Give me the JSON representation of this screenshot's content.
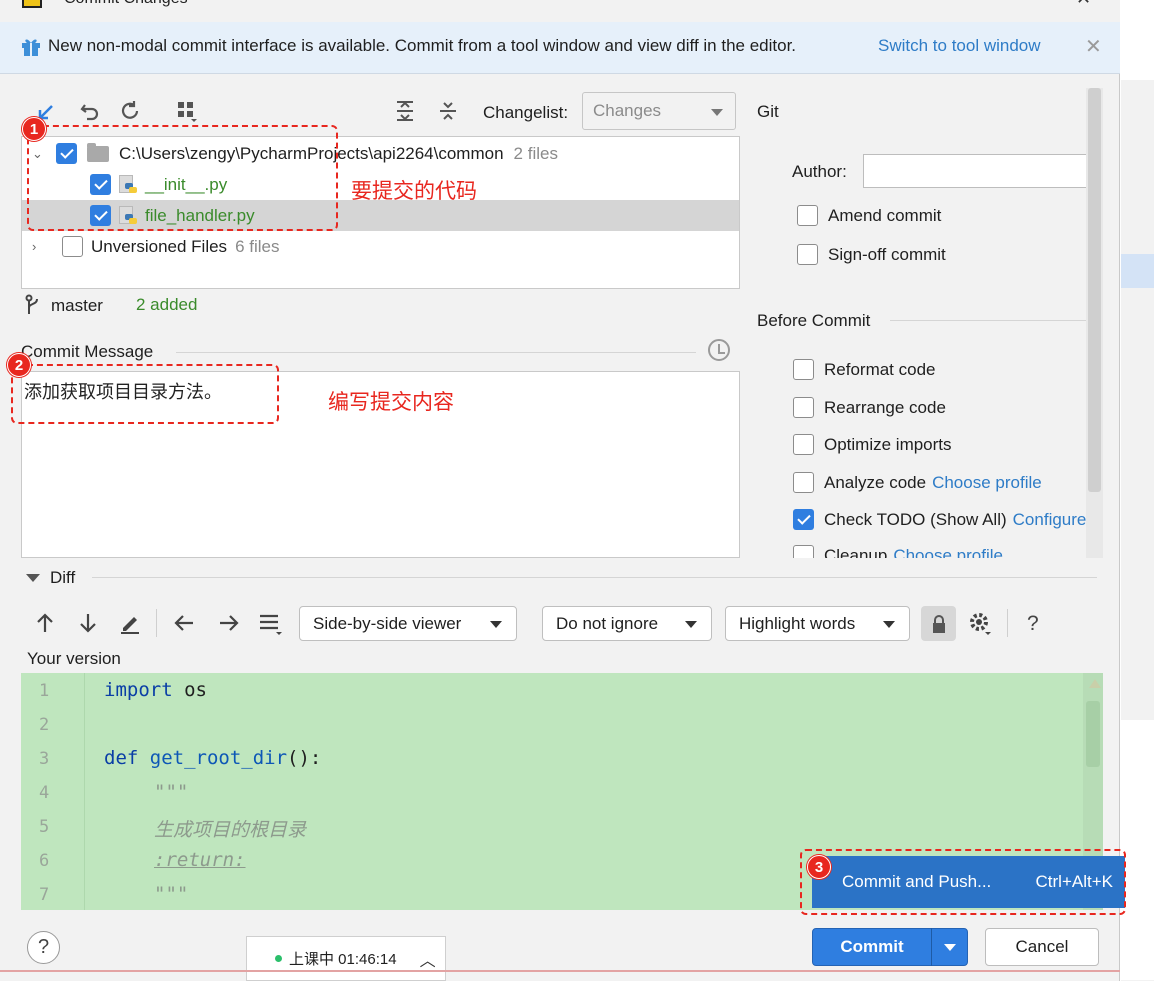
{
  "window": {
    "title": "Commit Changes"
  },
  "banner": {
    "text": "New non-modal commit interface is available. Commit from a tool window and view diff in the editor.",
    "link": "Switch to tool window"
  },
  "toolbar": {
    "changelist_label": "Changelist:",
    "changelist_value": "Changes"
  },
  "tree": {
    "root": {
      "path": "C:\\Users\\zengy\\PycharmProjects\\api2264\\common",
      "count": "2 files"
    },
    "files": [
      "__init__.py",
      "file_handler.py"
    ],
    "unversioned": {
      "label": "Unversioned Files",
      "count": "6 files"
    }
  },
  "annotations": {
    "n1": "1",
    "n1_text": "要提交的代码",
    "n2": "2",
    "n2_text": "编写提交内容",
    "n3": "3"
  },
  "branch": {
    "name": "master",
    "status": "2 added"
  },
  "message": {
    "label": "Commit Message",
    "text": "添加获取项目目录方法。"
  },
  "git": {
    "header": "Git",
    "author_label": "Author:",
    "author_value": "",
    "amend": "Amend commit",
    "signoff": "Sign-off commit"
  },
  "before_commit": {
    "header": "Before Commit",
    "reformat": "Reformat code",
    "rearrange": "Rearrange code",
    "optimize": "Optimize imports",
    "analyze": "Analyze code",
    "analyze_link": "Choose profile",
    "todo": "Check TODO (Show All)",
    "todo_link": "Configure",
    "cleanup": "Cleanup",
    "cleanup_link": "Choose profile"
  },
  "diff": {
    "header": "Diff",
    "viewer": "Side-by-side viewer",
    "ignore": "Do not ignore",
    "highlight": "Highlight words",
    "help": "?",
    "your_version": "Your version",
    "lines": [
      {
        "n": "1",
        "parts": [
          [
            "kw",
            "import"
          ],
          [
            "",
            "os"
          ]
        ]
      },
      {
        "n": "2",
        "parts": []
      },
      {
        "n": "3",
        "parts": [
          [
            "kw",
            "def"
          ],
          [
            "fn",
            "get_root_dir"
          ],
          [
            "",
            "():"
          ]
        ]
      },
      {
        "n": "4",
        "parts": [
          [
            "cm",
            "\"\"\""
          ]
        ]
      },
      {
        "n": "5",
        "parts": [
          [
            "cm",
            "生成项目的根目录"
          ]
        ]
      },
      {
        "n": "6",
        "parts": [
          [
            "cm",
            ":return:"
          ]
        ]
      },
      {
        "n": "7",
        "parts": [
          [
            "cm",
            "\"\"\""
          ]
        ]
      }
    ]
  },
  "popup": {
    "label": "Commit and Push...",
    "shortcut": "Ctrl+Alt+K"
  },
  "footer": {
    "help": "?",
    "timer": "上课中 01:46:14",
    "commit": "Commit",
    "cancel": "Cancel"
  },
  "colors": {
    "accent": "#2f7ee0",
    "annotation": "#e8271f",
    "diff_added": "#bfe6be"
  }
}
